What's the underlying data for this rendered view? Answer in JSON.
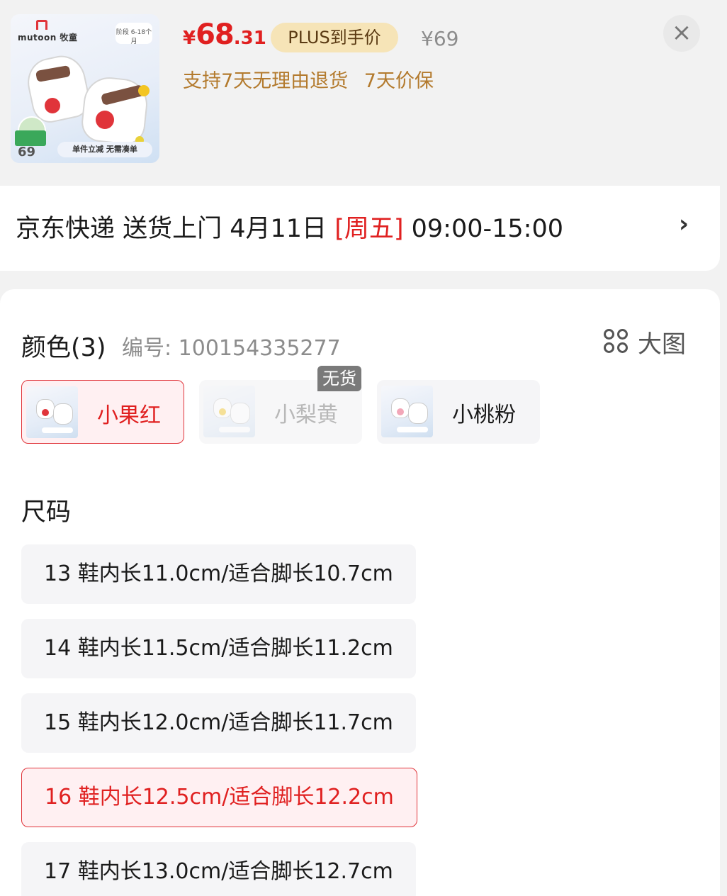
{
  "product": {
    "thumb": {
      "brand_text": "mutoon 牧童",
      "stage_text": "阶段 6-18个月",
      "price_text": "69",
      "promo_text": "单件立减 无需凑单"
    },
    "price": {
      "symbol": "¥",
      "integer": "68",
      "decimal": ".31"
    },
    "plus_label": "PLUS到手价",
    "original_price": "¥69",
    "guarantees": [
      "支持7天无理由退货",
      "7天价保"
    ]
  },
  "delivery": {
    "prefix": "京东快递 送货上门 4月11日 ",
    "weekday": "[周五]",
    "time": " 09:00-15:00",
    "arrow": "›"
  },
  "color": {
    "title": "颜色(3)",
    "sku": "编号: 100154335277",
    "big_picture": "大图",
    "out_of_stock_label": "无货",
    "options": [
      {
        "label": "小果红",
        "state": "selected",
        "accent": "#e0343a"
      },
      {
        "label": "小梨黄",
        "state": "disabled",
        "accent": "#f3c522"
      },
      {
        "label": "小桃粉",
        "state": "normal",
        "accent": "#f2a7b8"
      }
    ]
  },
  "size": {
    "title": "尺码",
    "options": [
      {
        "label": "13 鞋内长11.0cm/适合脚长10.7cm",
        "state": "normal"
      },
      {
        "label": "14 鞋内长11.5cm/适合脚长11.2cm",
        "state": "normal"
      },
      {
        "label": "15 鞋内长12.0cm/适合脚长11.7cm",
        "state": "normal"
      },
      {
        "label": "16 鞋内长12.5cm/适合脚长12.2cm",
        "state": "selected"
      },
      {
        "label": "17 鞋内长13.0cm/适合脚长12.7cm",
        "state": "normal"
      }
    ]
  },
  "colors": {
    "accent": "#e02020",
    "gold": "#b37a2d",
    "plus_bg": "#f6e4b7"
  }
}
